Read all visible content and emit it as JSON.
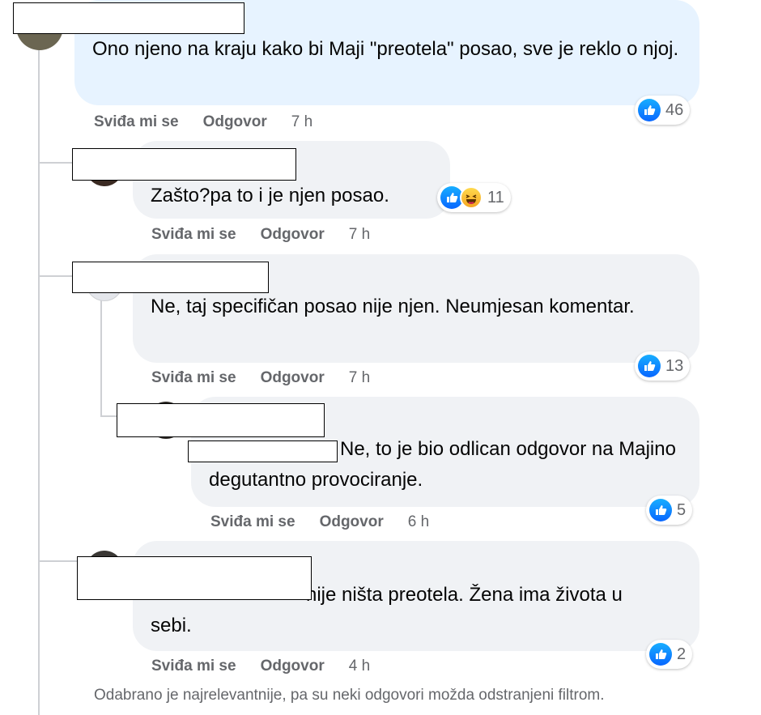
{
  "comments": [
    {
      "text": "Ono njeno na kraju kako bi Maji \"preotela\" posao, sve je reklo o njoj.",
      "reactions": "46",
      "like_label": "Sviđa mi se",
      "reply_label": "Odgovor",
      "time": "7 h"
    },
    {
      "text": "Zašto?pa to i je njen posao.",
      "reactions": "11",
      "like_label": "Sviđa mi se",
      "reply_label": "Odgovor",
      "time": "7 h"
    },
    {
      "text": "Ne, taj specifičan posao nije njen. Neumjesan komentar.",
      "reactions": "13",
      "like_label": "Sviđa mi se",
      "reply_label": "Odgovor",
      "time": "7 h"
    },
    {
      "text": "Ne, to je bio odlican odgovor na Majino degutantno provociranje.",
      "reactions": "5",
      "like_label": "Sviđa mi se",
      "reply_label": "Odgovor",
      "time": "6 h"
    },
    {
      "text": "nije ništa preotela. Žena ima života u sebi.",
      "reactions": "2",
      "like_label": "Sviđa mi se",
      "reply_label": "Odgovor",
      "time": "4 h"
    }
  ],
  "footer_note": "Odabrano je najrelevantnije, pa su neki odgovori možda odstranjeni filtrom.",
  "colors": {
    "like_blue": "#0866ff",
    "meta_grey": "#65676b",
    "bubble_grey": "#f0f2f5",
    "bubble_blue": "#e7f3ff"
  }
}
